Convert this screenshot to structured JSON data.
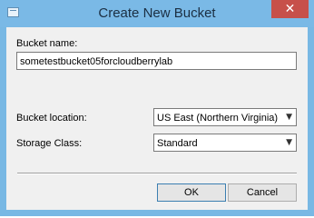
{
  "window": {
    "title": "Create New Bucket",
    "close_label": "✕"
  },
  "form": {
    "bucket_name_label": "Bucket name:",
    "bucket_name_value": "sometestbucket05forcloudberrylab",
    "bucket_location_label": "Bucket location:",
    "bucket_location_value": "US East (Northern Virginia)",
    "storage_class_label": "Storage Class:",
    "storage_class_value": "Standard"
  },
  "buttons": {
    "ok_label": "OK",
    "cancel_label": "Cancel"
  },
  "icons": {
    "dropdown": "▼"
  }
}
